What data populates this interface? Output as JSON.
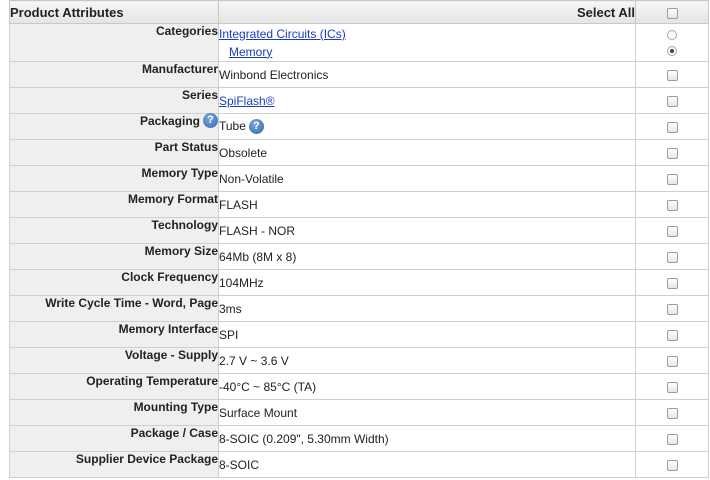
{
  "header": {
    "title": "Product Attributes",
    "select_all": "Select All",
    "help_glyph": "?"
  },
  "categories": {
    "label": "Categories",
    "level1": "Integrated Circuits (ICs)",
    "level2": "Memory",
    "selected": "level2"
  },
  "attributes": [
    {
      "label": "Manufacturer",
      "value": "Winbond Electronics"
    },
    {
      "label": "Series",
      "value": "SpiFlash®",
      "link": true
    },
    {
      "label": "Packaging",
      "value": "Tube",
      "help": true
    },
    {
      "label": "Part Status",
      "value": "Obsolete"
    },
    {
      "label": "Memory Type",
      "value": "Non-Volatile"
    },
    {
      "label": "Memory Format",
      "value": "FLASH"
    },
    {
      "label": "Technology",
      "value": "FLASH - NOR"
    },
    {
      "label": "Memory Size",
      "value": "64Mb (8M x 8)"
    },
    {
      "label": "Clock Frequency",
      "value": "104MHz"
    },
    {
      "label": "Write Cycle Time - Word, Page",
      "value": "3ms"
    },
    {
      "label": "Memory Interface",
      "value": "SPI"
    },
    {
      "label": "Voltage - Supply",
      "value": "2.7 V ~ 3.6 V"
    },
    {
      "label": "Operating Temperature",
      "value": "-40°C ~ 85°C (TA)"
    },
    {
      "label": "Mounting Type",
      "value": "Surface Mount"
    },
    {
      "label": "Package / Case",
      "value": "8-SOIC (0.209\", 5.30mm Width)"
    },
    {
      "label": "Supplier Device Package",
      "value": "8-SOIC"
    }
  ]
}
